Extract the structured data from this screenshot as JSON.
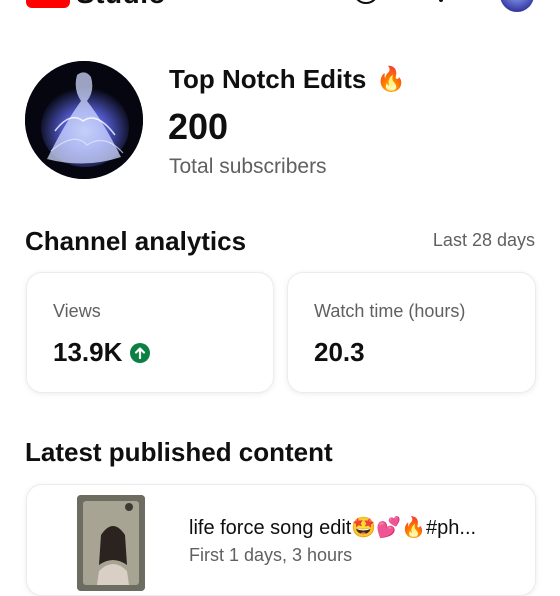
{
  "app": {
    "logo_text": "Studio"
  },
  "profile": {
    "channel_name": "Top Notch Edits",
    "channel_emoji": "🔥",
    "subscriber_count": "200",
    "subscriber_label": "Total subscribers"
  },
  "analytics": {
    "title": "Channel analytics",
    "range": "Last 28 days",
    "cards": [
      {
        "label": "Views",
        "value": "13.9K",
        "trend": "up"
      },
      {
        "label": "Watch time (hours)",
        "value": "20.3"
      }
    ]
  },
  "latest": {
    "title": "Latest published content",
    "video": {
      "title": "life force  song edit🤩💕🔥#ph...",
      "age": "First 1 days, 3 hours"
    }
  },
  "colors": {
    "accent": "#ff0000",
    "trend_up": "#0b8043",
    "secondary_text": "#606060"
  },
  "icons": [
    "help-icon",
    "notifications-icon",
    "trend-up-icon",
    "fire-icon"
  ]
}
